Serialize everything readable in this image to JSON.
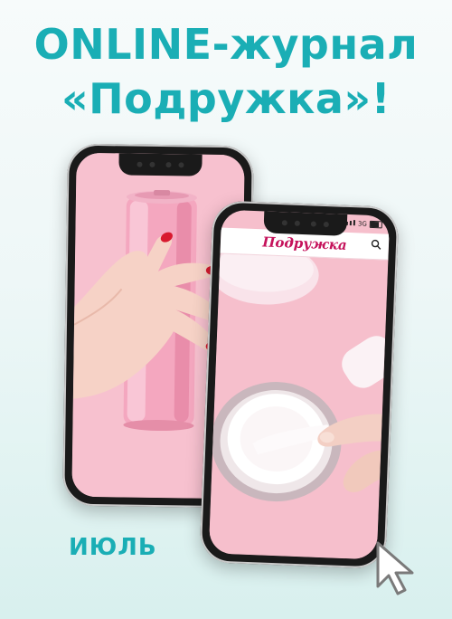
{
  "headline": {
    "line1": "ONLINE-журнал",
    "line2": "«Подружка»!"
  },
  "phone2": {
    "status": {
      "network": "3G"
    },
    "brand_logo": "Подружка"
  },
  "month_label": "ИЮЛЬ",
  "colors": {
    "accent": "#1aaeb5",
    "brand": "#c5125b",
    "pink": "#f7c1cf"
  },
  "icons": [
    "search-icon",
    "cursor-arrow-icon",
    "signal-icon",
    "battery-icon"
  ]
}
